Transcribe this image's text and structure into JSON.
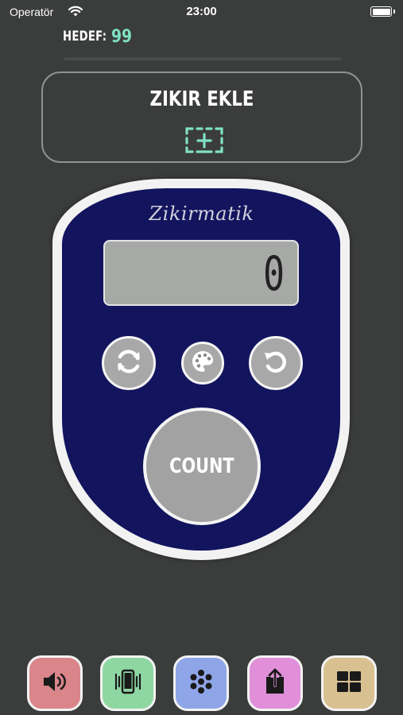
{
  "status_bar": {
    "carrier": "Operatör",
    "time": "23:00"
  },
  "target": {
    "label": "HEDEF:",
    "value": "99"
  },
  "add_zikr": {
    "title": "ZIKIR EKLE",
    "icon": "add-frame-icon"
  },
  "counter": {
    "brand": "Zikirmatik",
    "display_value": "0",
    "count_label": "COUNT"
  },
  "controls": [
    {
      "name": "sync",
      "icon": "sync-icon"
    },
    {
      "name": "theme",
      "icon": "palette-icon"
    },
    {
      "name": "undo",
      "icon": "undo-icon"
    }
  ],
  "toolbar": [
    {
      "name": "sound",
      "icon": "speaker-icon",
      "color": "#d9858a"
    },
    {
      "name": "vibrate",
      "icon": "vibrate-icon",
      "color": "#8ed7a2"
    },
    {
      "name": "beads",
      "icon": "beads-icon",
      "color": "#8ea5e8"
    },
    {
      "name": "share",
      "icon": "share-icon",
      "color": "#e08fd8"
    },
    {
      "name": "layout",
      "icon": "grid-icon",
      "color": "#d8c090"
    }
  ],
  "colors": {
    "background": "#3b3c3c",
    "device_body": "#12145e",
    "accent": "#7fe0c2",
    "lcd": "#a7a9a7"
  }
}
